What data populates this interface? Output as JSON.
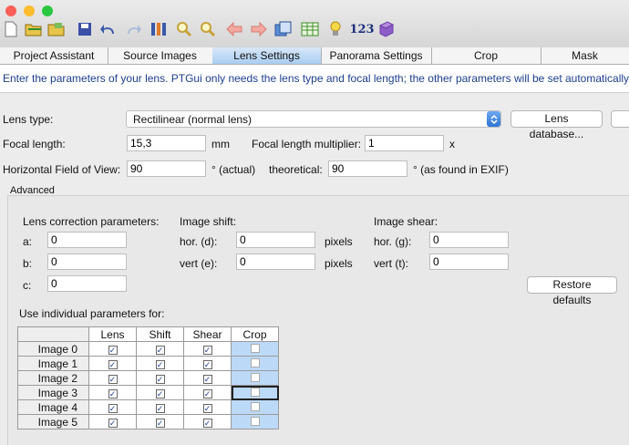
{
  "toolbar": {
    "icons": [
      "new-document-icon",
      "open-folder-icon",
      "open-images-icon",
      "save-icon",
      "undo-icon",
      "redo-icon",
      "tools-icon",
      "zoom-in-icon",
      "zoom-out-icon",
      "back-arrow-icon",
      "forward-arrow-icon",
      "panorama-editor-icon",
      "table-icon",
      "lightbulb-icon",
      "numbers-icon",
      "book-icon"
    ],
    "numbers_label": "123"
  },
  "tabs": [
    "Project Assistant",
    "Source Images",
    "Lens Settings",
    "Panorama Settings",
    "Crop",
    "Mask"
  ],
  "active_tab": "Lens Settings",
  "info_text": "Enter the parameters of your lens. PTGui only needs the lens type and focal length; the other parameters will be set automatically. If",
  "lens": {
    "type_label": "Lens type:",
    "type_value": "Rectilinear (normal lens)",
    "database_button": "Lens database...",
    "focal_label": "Focal length:",
    "focal_value": "15,3",
    "focal_unit": "mm",
    "multiplier_label": "Focal length multiplier:",
    "multiplier_value": "1",
    "multiplier_unit": "x",
    "hfov_label": "Horizontal Field of View:",
    "hfov_value": "90",
    "hfov_suffix": "° (actual)",
    "theoretical_label": "theoretical:",
    "theoretical_value": "90",
    "theoretical_suffix": "° (as found in EXIF)"
  },
  "advanced": {
    "title": "Advanced",
    "correction_title": "Lens correction parameters:",
    "a_label": "a:",
    "a_value": "0",
    "b_label": "b:",
    "b_value": "0",
    "c_label": "c:",
    "c_value": "0",
    "shift_title": "Image shift:",
    "hor_d_label": "hor. (d):",
    "hor_d_value": "0",
    "vert_e_label": "vert (e):",
    "vert_e_value": "0",
    "pixels_label": "pixels",
    "shear_title": "Image shear:",
    "hor_g_label": "hor. (g):",
    "hor_g_value": "0",
    "vert_t_label": "vert (t):",
    "vert_t_value": "0",
    "restore_button": "Restore defaults",
    "individual_title": "Use individual parameters for:"
  },
  "grid": {
    "columns": [
      "Lens",
      "Shift",
      "Shear",
      "Crop"
    ],
    "rows": [
      {
        "label": "Image 0",
        "lens": true,
        "shift": true,
        "shear": true,
        "crop": false
      },
      {
        "label": "Image 1",
        "lens": true,
        "shift": true,
        "shear": true,
        "crop": false
      },
      {
        "label": "Image 2",
        "lens": true,
        "shift": true,
        "shear": true,
        "crop": false
      },
      {
        "label": "Image 3",
        "lens": true,
        "shift": true,
        "shear": true,
        "crop": false
      },
      {
        "label": "Image 4",
        "lens": true,
        "shift": true,
        "shear": true,
        "crop": false
      },
      {
        "label": "Image 5",
        "lens": true,
        "shift": true,
        "shear": true,
        "crop": false
      }
    ]
  },
  "colors": {
    "accent": "#a9cdf2",
    "info_text": "#1c3f8f",
    "crop_column": "#bcd9f7"
  }
}
